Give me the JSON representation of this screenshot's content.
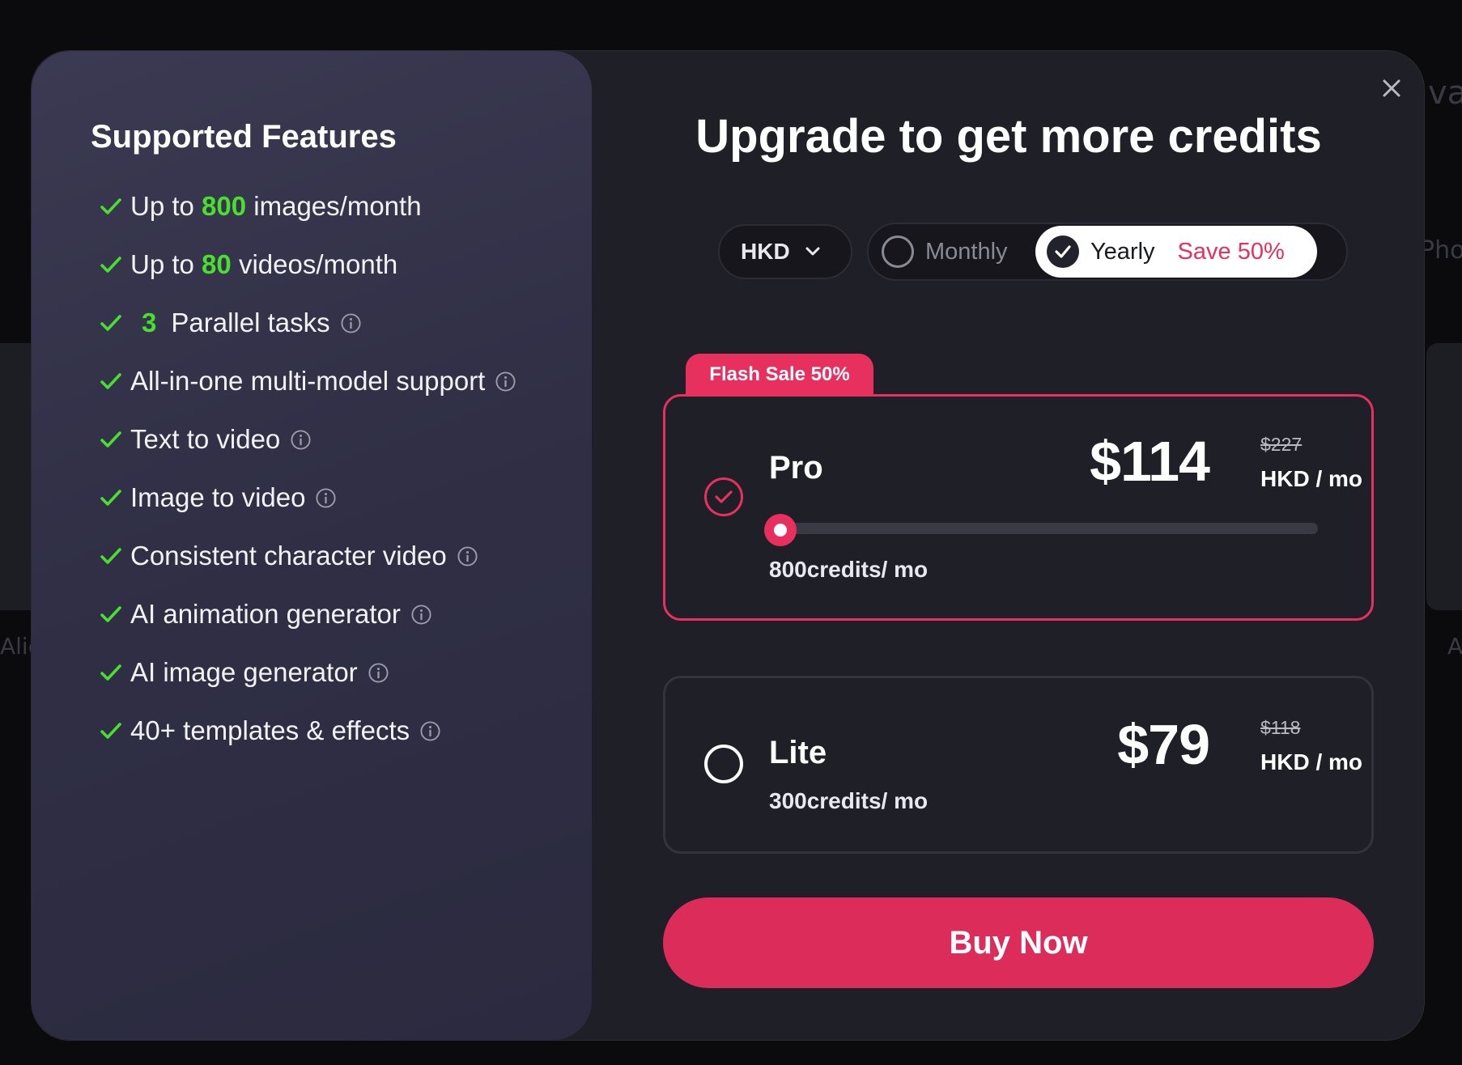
{
  "background": {
    "right_top_fragment": "vat",
    "right_mid_fragment": "Pho",
    "left_fragment": "Alie",
    "right_low_fragment": "A"
  },
  "features": {
    "title": "Supported Features",
    "items": [
      {
        "prefix": "Up to",
        "highlight": "800",
        "text": "images/month",
        "info": false
      },
      {
        "prefix": "Up to",
        "highlight": "80",
        "text": "videos/month",
        "info": false
      },
      {
        "prefix": "",
        "highlight": "3",
        "text": "Parallel tasks",
        "info": true
      },
      {
        "prefix": "",
        "highlight": "",
        "text": "All-in-one multi-model support",
        "info": true
      },
      {
        "prefix": "",
        "highlight": "",
        "text": "Text to video",
        "info": true
      },
      {
        "prefix": "",
        "highlight": "",
        "text": "Image to video",
        "info": true
      },
      {
        "prefix": "",
        "highlight": "",
        "text": "Consistent character video",
        "info": true
      },
      {
        "prefix": "",
        "highlight": "",
        "text": "AI animation generator",
        "info": true
      },
      {
        "prefix": "",
        "highlight": "",
        "text": "AI image generator",
        "info": true
      },
      {
        "prefix": "",
        "highlight": "",
        "text": "40+ templates & effects",
        "info": true
      }
    ]
  },
  "header": {
    "title": "Upgrade to get more credits",
    "close_icon": "close-icon"
  },
  "currency": {
    "selected": "HKD"
  },
  "billing": {
    "monthly_label": "Monthly",
    "yearly_label": "Yearly",
    "save_label": "Save 50%",
    "selected": "Yearly"
  },
  "plans": {
    "flash_sale": "Flash Sale 50%",
    "pro": {
      "name": "Pro",
      "price": "$114",
      "old_price": "$227",
      "period": "HKD / mo",
      "credits": "800credits/ mo",
      "slider_level": 0,
      "selected": true
    },
    "lite": {
      "name": "Lite",
      "price": "$79",
      "old_price": "$118",
      "period": "HKD / mo",
      "credits": "300credits/ mo",
      "selected": false
    }
  },
  "actions": {
    "buy_label": "Buy Now"
  },
  "colors": {
    "accent": "#e8305e",
    "highlight_green": "#4ade2e",
    "panel": "#1f1f27",
    "feature_panel": "#34334a"
  }
}
